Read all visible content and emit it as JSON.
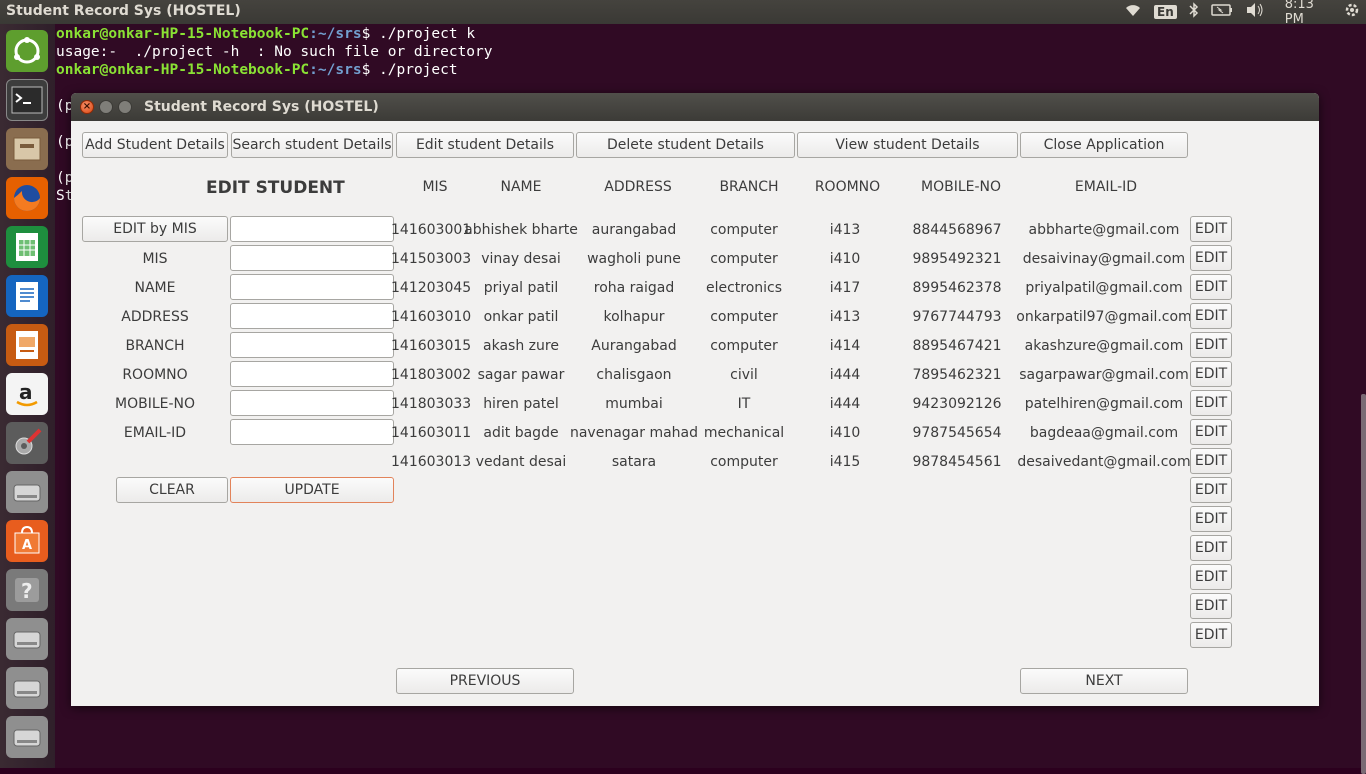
{
  "topbar": {
    "title": "Student Record Sys (HOSTEL)",
    "lang": "En",
    "time": "8:13 PM"
  },
  "launcher": {
    "icons": [
      "ubuntu-dash-icon",
      "terminal-icon",
      "files-icon",
      "firefox-icon",
      "calc-icon",
      "writer-icon",
      "impress-icon",
      "amazon-icon",
      "settings-icon",
      "drive-icon",
      "software-center-icon",
      "help-icon",
      "drive-icon",
      "drive-icon",
      "drive-icon"
    ]
  },
  "terminal": {
    "lines": [
      {
        "user": "onkar@onkar-HP-15-Notebook-PC",
        "path": ":~/srs",
        "rest": "$ ./project k"
      },
      {
        "plain": "usage:-  ./project -h  : No such file or directory"
      },
      {
        "user": "onkar@onkar-HP-15-Notebook-PC",
        "path": ":~/srs",
        "rest": "$ ./project"
      }
    ],
    "frag1": "(p",
    "frag2": "(p",
    "frag3": "(p",
    "frag4": "St"
  },
  "window": {
    "title": "Student Record Sys (HOSTEL)",
    "close_glyph": "×"
  },
  "toolbar": {
    "add": "Add Student Details",
    "search": "Search student Details",
    "edit": "Edit student Details",
    "delete": "Delete student Details",
    "view": "View student Details",
    "close": "Close Application"
  },
  "form": {
    "heading": "EDIT STUDENT",
    "edit_by_mis": "EDIT by MIS",
    "labels": [
      "MIS",
      "NAME",
      "ADDRESS",
      "BRANCH",
      "ROOMNO",
      "MOBILE-NO",
      "EMAIL-ID"
    ],
    "clear": "CLEAR",
    "update": "UPDATE"
  },
  "table": {
    "headers": [
      "MIS",
      "NAME",
      "ADDRESS",
      "BRANCH",
      "ROOMNO",
      "MOBILE-NO",
      "EMAIL-ID"
    ],
    "rows": [
      [
        "141603001",
        "abhishek bharte",
        "aurangabad",
        "computer",
        "i413",
        "8844568967",
        "abbharte@gmail.com"
      ],
      [
        "141503003",
        "vinay desai",
        "wagholi pune",
        "computer",
        "i410",
        "9895492321",
        "desaivinay@gmail.com"
      ],
      [
        "141203045",
        "priyal patil",
        "roha raigad",
        "electronics",
        "i417",
        "8995462378",
        "priyalpatil@gmail.com"
      ],
      [
        "141603010",
        "onkar patil",
        "kolhapur",
        "computer",
        "i413",
        "9767744793",
        "onkarpatil97@gmail.com"
      ],
      [
        "141603015",
        "akash zure",
        "Aurangabad",
        "computer",
        "i414",
        "8895467421",
        "akashzure@gmail.com"
      ],
      [
        "141803002",
        "sagar pawar",
        "chalisgaon",
        "civil",
        "i444",
        "7895462321",
        "sagarpawar@gmail.com"
      ],
      [
        "141803033",
        "hiren patel",
        "mumbai",
        "IT",
        "i444",
        "9423092126",
        "patelhiren@gmail.com"
      ],
      [
        "141603011",
        "adit bagde",
        "navenagar mahad",
        "mechanical",
        "i410",
        "9787545654",
        "bagdeaa@gmail.com"
      ],
      [
        "141603013",
        "vedant desai",
        "satara",
        "computer",
        "i415",
        "9878454561",
        "desaivedant@gmail.com"
      ]
    ],
    "edit_label": "EDIT",
    "edit_count": 15
  },
  "pager": {
    "previous": "PREVIOUS",
    "next": "NEXT"
  }
}
